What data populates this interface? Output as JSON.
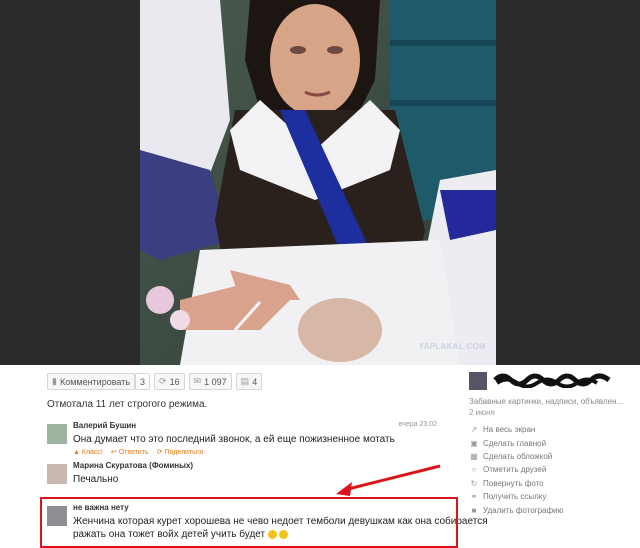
{
  "photo": {
    "watermark": "YAPLAKAL.COM"
  },
  "actions": {
    "comment": {
      "label": "Комментировать",
      "count": "3"
    },
    "reshare": {
      "count": "16"
    },
    "likes": {
      "count": "1 097"
    },
    "stats": {
      "count": "4"
    }
  },
  "caption": "Отмотала 11 лет строгого режима.",
  "comments": [
    {
      "author": "Валерий Бушин",
      "time": "вчера 23:02",
      "text": "Она думает что это последний звонок, а ей еще пожизненное мотать",
      "actions": [
        "Класс!",
        "Ответить",
        "Поделиться"
      ]
    },
    {
      "author": "Марина Скуратова (Фоминых)",
      "text": "Печально"
    },
    {
      "author": "не важна нету",
      "text_line1": "Женчина которая курет хорошева не чево недоет темболи девушкам как она собирается",
      "text_line2": "ражать она тожет войх детей учить будет"
    }
  ],
  "sidebar": {
    "album": "Забавные картинки, надписи, объявлен...",
    "date": "2 июня",
    "menu": [
      {
        "icon": "fullscreen-icon",
        "label": "На весь экран"
      },
      {
        "icon": "image-icon",
        "label": "Сделать главной"
      },
      {
        "icon": "cover-icon",
        "label": "Сделать обложкой"
      },
      {
        "icon": "tag-icon",
        "label": "Отметить друзей"
      },
      {
        "icon": "rotate-icon",
        "label": "Повернуть фото"
      },
      {
        "icon": "link-icon",
        "label": "Получить ссылку"
      },
      {
        "icon": "trash-icon",
        "label": "Удалить фотографию"
      }
    ]
  },
  "colors": {
    "highlight": "#d9141b",
    "accent": "#e47b16",
    "stage": "#2b2b2b"
  }
}
